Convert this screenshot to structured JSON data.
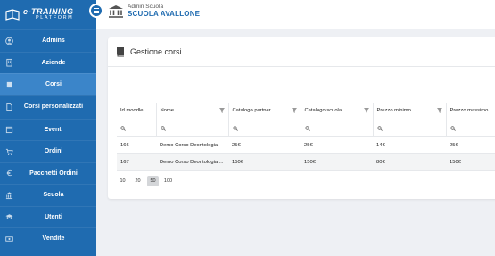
{
  "brand": {
    "name": "e-TRAINING",
    "tagline": "PLATFORM"
  },
  "sidebar": {
    "items": [
      {
        "label": "Admins",
        "icon": "user-circle-icon"
      },
      {
        "label": "Aziende",
        "icon": "building-icon"
      },
      {
        "label": "Corsi",
        "icon": "book-icon",
        "active": true
      },
      {
        "label": "Corsi personalizzati",
        "icon": "document-icon"
      },
      {
        "label": "Eventi",
        "icon": "calendar-icon"
      },
      {
        "label": "Ordini",
        "icon": "cart-icon"
      },
      {
        "label": "Pacchetti Ordini",
        "icon": "euro-icon"
      },
      {
        "label": "Scuola",
        "icon": "bank-icon"
      },
      {
        "label": "Utenti",
        "icon": "graduation-cap-icon"
      },
      {
        "label": "Vendite",
        "icon": "money-icon"
      }
    ]
  },
  "header": {
    "role": "Admin Scuola",
    "school": "SCUOLA AVALLONE"
  },
  "card": {
    "title": "Gestione corsi"
  },
  "table": {
    "columns": [
      "Id moodle",
      "Nome",
      "Catalogo partner",
      "Catalogo scuola",
      "Prezzo minimo",
      "Prezzo massimo"
    ],
    "rows": [
      [
        "166",
        "Demo Corso Deontologia",
        "25€",
        "25€",
        "14€",
        "25€"
      ],
      [
        "167",
        "Demo Corso Deontologia ...",
        "150€",
        "150€",
        "80€",
        "150€"
      ]
    ]
  },
  "pager": {
    "sizes": [
      "10",
      "20",
      "50",
      "100"
    ],
    "selected": "50"
  },
  "colors": {
    "sidebar": "#1f6bb0",
    "active": "#3b85c9",
    "accent": "#1f6bb0"
  }
}
